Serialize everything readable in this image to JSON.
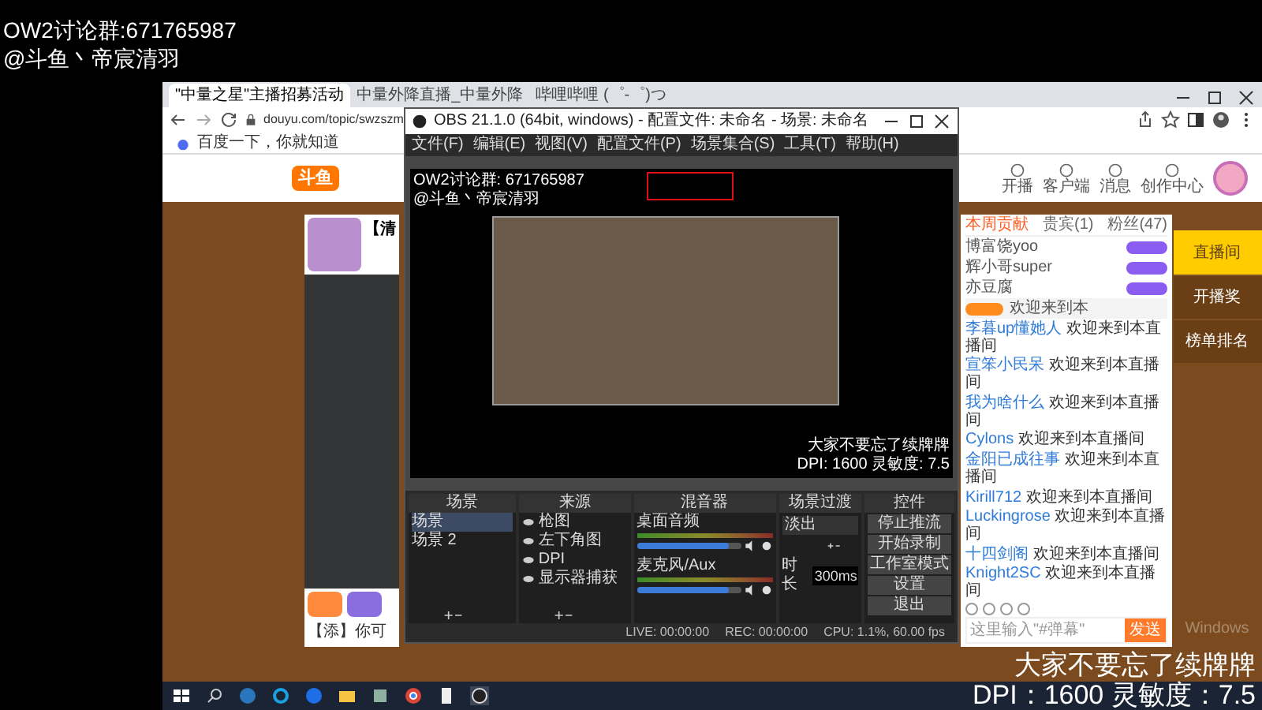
{
  "overlay": {
    "group_line": "OW2讨论群:671765987",
    "streamer_line": "@斗鱼丶帝宸清羽"
  },
  "browser": {
    "tabs": [
      {
        "label": "\"中量之星\"主播招募活动",
        "selected": true
      },
      {
        "label": "中量外降直播_中量外降",
        "selected": false
      },
      {
        "label": "哔哩哔哩 (゜-゜)つ",
        "selected": false
      }
    ],
    "url": "douyu.com/topic/swzszm",
    "bookmarks": [
      "百度一下，你就知道"
    ]
  },
  "douyu": {
    "logo": "斗鱼",
    "nav": [
      "开播",
      "客户端",
      "消息",
      "创作中心"
    ],
    "card_title": "【清",
    "promo_text": "【添】你可",
    "chat_tabs": [
      {
        "label": "本周贡献",
        "selected": true
      },
      {
        "label": "贵宾(1)",
        "selected": false
      },
      {
        "label": "粉丝(47)",
        "selected": false
      }
    ],
    "users": [
      "博富饶yoo",
      "辉小哥super",
      "亦豆腐"
    ],
    "gift_line": "欢迎来到本",
    "messages": [
      {
        "user": "李暮up懂她人",
        "text": "欢迎来到本直播间"
      },
      {
        "user": "宣笨小民呆",
        "text": "欢迎来到本直播间"
      },
      {
        "user": "我为啥什么",
        "text": "欢迎来到本直播间"
      },
      {
        "user": "Cylons",
        "text": "欢迎来到本直播间"
      },
      {
        "user": "金阳已成往事",
        "text": "欢迎来到本直播间"
      },
      {
        "user": "Kirill712",
        "text": "欢迎来到本直播间"
      },
      {
        "user": "Luckingrose",
        "text": "欢迎来到本直播间"
      },
      {
        "user": "十四剑阁",
        "text": "欢迎来到本直播间"
      },
      {
        "user": "Knight2SC",
        "text": "欢迎来到本直播间"
      }
    ],
    "input_placeholder": "这里输入\"#弹幕\"",
    "send": "发送",
    "side_buttons": [
      {
        "label": "直播间",
        "selected": true
      },
      {
        "label": "开播奖",
        "selected": false
      },
      {
        "label": "榜单排名",
        "selected": false
      }
    ]
  },
  "activation_notice": "Windows",
  "obs": {
    "title": "OBS 21.1.0 (64bit, windows) - 配置文件: 未命名 - 场景: 未命名",
    "menu": [
      "文件(F)",
      "编辑(E)",
      "视图(V)",
      "配置文件(P)",
      "场景集合(S)",
      "工具(T)",
      "帮助(H)"
    ],
    "preview": {
      "group_line": "OW2讨论群: 671765987",
      "streamer_line": "@斗鱼丶帝宸清羽",
      "caption": "大家不要忘了续牌牌",
      "dpi_line": "DPI: 1600 灵敏度: 7.5"
    },
    "docks": [
      "场景",
      "来源",
      "混音器",
      "场景过渡",
      "控件"
    ],
    "scenes": [
      {
        "name": "场景",
        "selected": true
      },
      {
        "name": "场景 2",
        "selected": false
      }
    ],
    "sources": [
      "枪图",
      "左下角图",
      "DPI",
      "显示器捕获"
    ],
    "channels": [
      {
        "name": "桌面音频",
        "level": 0.88
      },
      {
        "name": "麦克风/Aux",
        "level": 0.88
      }
    ],
    "transition": "淡出",
    "duration_label": "时长",
    "duration": "300ms",
    "controls": [
      "停止推流",
      "开始录制",
      "工作室模式",
      "设置",
      "退出"
    ],
    "status": [
      "LIVE: 00:00:00",
      "REC: 00:00:00",
      "CPU: 1.1%, 60.00 fps"
    ]
  },
  "caption": "大家不要忘了续牌牌",
  "dpi_line": "DPI：1600 灵敏度：7.5"
}
